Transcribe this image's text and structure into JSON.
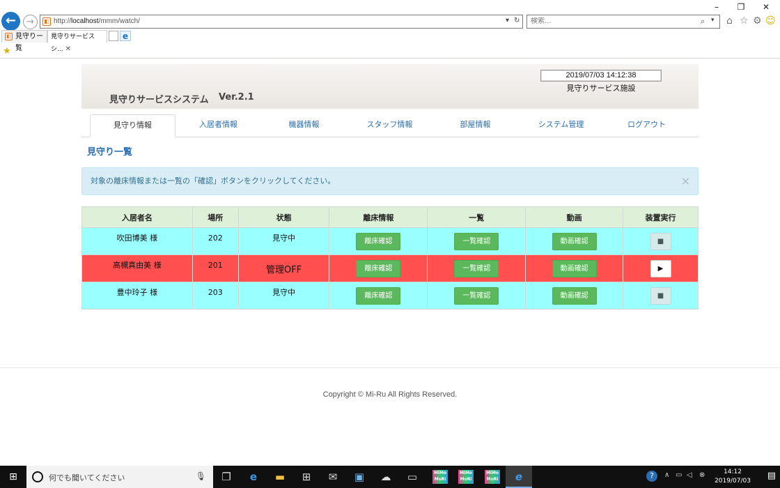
{
  "browser": {
    "window_buttons": [
      "–",
      "❐",
      "✕"
    ],
    "address_prefix": "http://",
    "address_host": "localhost",
    "address_path": "/mmm/watch/",
    "search_placeholder": "検索...",
    "tabs": [
      {
        "label": "見守りー覧"
      },
      {
        "label": "見守りサービスシ..."
      }
    ],
    "tab_close": "✕"
  },
  "header": {
    "title": "見守りサービスシステム",
    "version": "Ver.2.1",
    "datetime": "2019/07/03 14:12:38",
    "facility": "見守りサービス施設"
  },
  "nav": {
    "tabs": [
      {
        "label": "見守り情報",
        "active": true
      },
      {
        "label": "入居者情報"
      },
      {
        "label": "機器情報"
      },
      {
        "label": "スタッフ情報"
      },
      {
        "label": "部屋情報"
      },
      {
        "label": "システム管理"
      },
      {
        "label": "ログアウト"
      }
    ]
  },
  "main": {
    "heading": "見守り一覧",
    "alert": "対象の離床情報または一覧の「確認」ボタンをクリックしてください。",
    "alert_close": "×",
    "table": {
      "headers": [
        "入居者名",
        "場所",
        "状態",
        "離床情報",
        "一覧",
        "動画",
        "装置実行"
      ],
      "rows": [
        {
          "name": "吹田博美 様",
          "place": "202",
          "state": "見守中",
          "bed_btn": "離床確認",
          "list_btn": "一覧確認",
          "video_btn": "動画確認",
          "exec_btn": "■",
          "status": "normal"
        },
        {
          "name": "高槻真由美 様",
          "place": "201",
          "state": "管理OFF",
          "bed_btn": "離床確認",
          "list_btn": "一覧確認",
          "video_btn": "動画確認",
          "exec_btn": "▶",
          "status": "alert"
        },
        {
          "name": "豊中玲子 様",
          "place": "203",
          "state": "見守中",
          "bed_btn": "離床確認",
          "list_btn": "一覧確認",
          "video_btn": "動画確認",
          "exec_btn": "■",
          "status": "normal"
        }
      ]
    }
  },
  "footer": {
    "copyright": "Copyright © Mi-Ru All Rights Reserved."
  },
  "taskbar": {
    "search_placeholder": "何でも聞いてください",
    "app_label": "MiMo MoRi",
    "time": "14:12",
    "date": "2019/07/03"
  },
  "colors": {
    "normal_row": "#99ffff",
    "alert_row": "#ff4f4f",
    "green_button": "#5cb85c",
    "header_bg": "#dff0d8",
    "link_blue": "#2a6eb0"
  }
}
